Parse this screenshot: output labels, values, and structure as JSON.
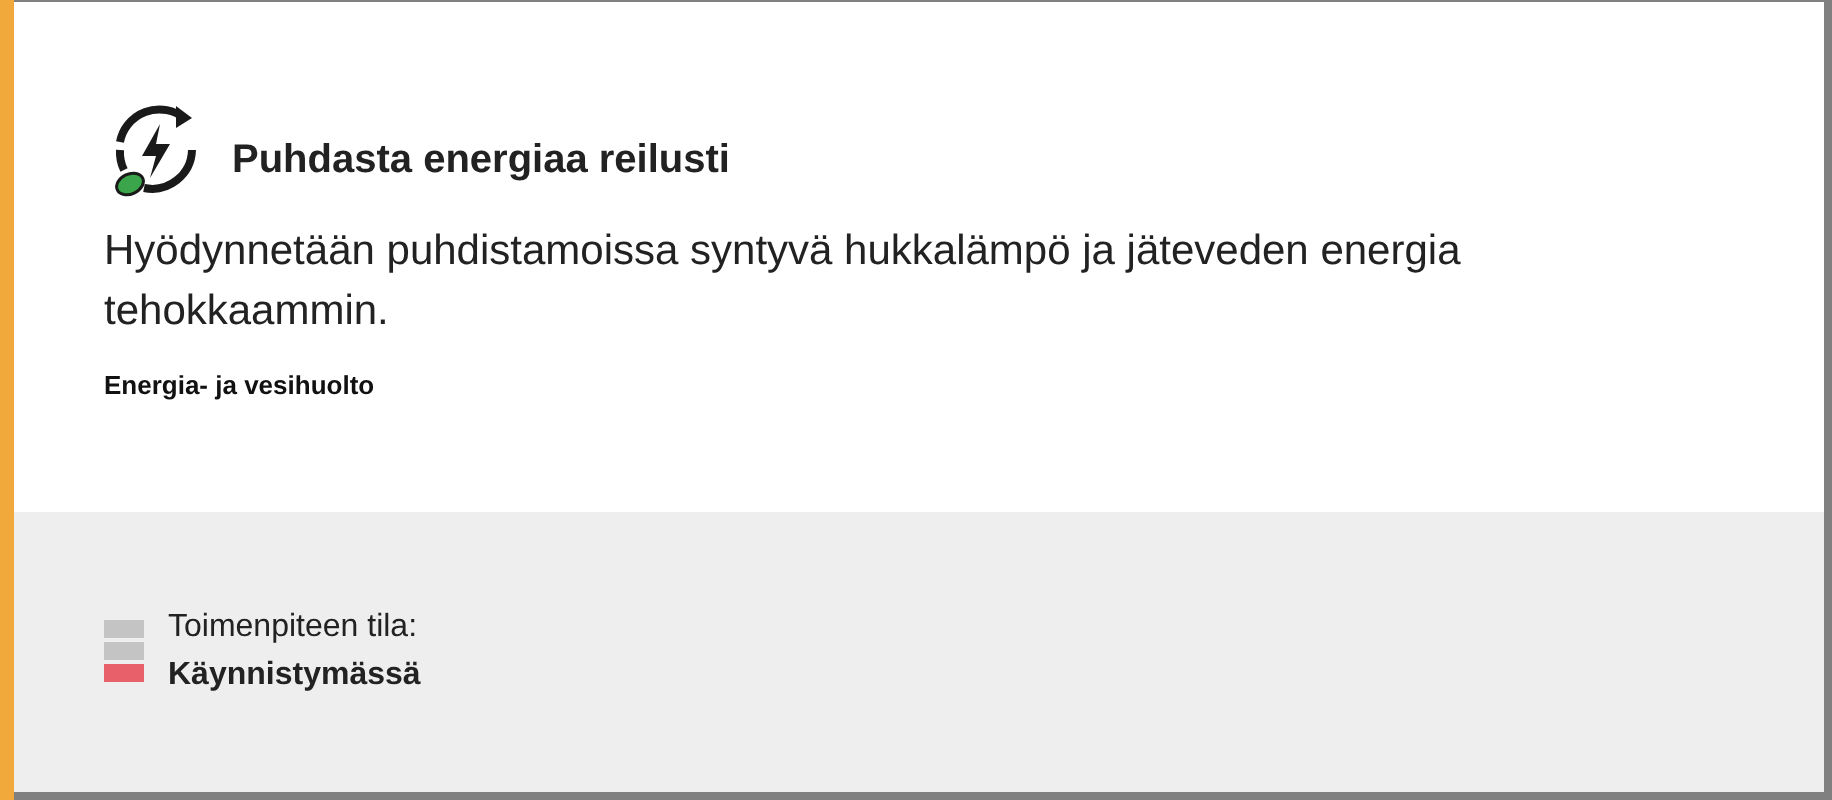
{
  "title": "Puhdasta energiaa reilusti",
  "description": "Hyödynnetään puhdistamoissa syntyvä hukkalämpö ja jäteveden energia tehokkaammin.",
  "category": "Energia- ja vesihuolto",
  "status": {
    "label": "Toimenpiteen tila:",
    "value": "Käynnistymässä",
    "steps": [
      {
        "on": false
      },
      {
        "on": false
      },
      {
        "on": true
      }
    ]
  }
}
